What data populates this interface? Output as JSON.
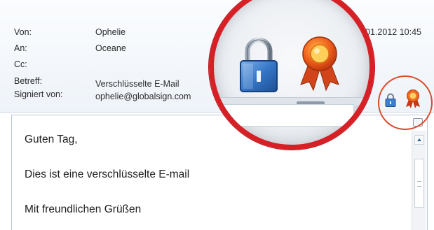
{
  "header": {
    "fields": [
      {
        "label": "Von:",
        "value": "Ophelie"
      },
      {
        "label": "An:",
        "value": "Oceane"
      },
      {
        "label": "Cc:",
        "value": ""
      },
      {
        "label": "Betreff:",
        "value": "Verschlüsselte E-Mail"
      },
      {
        "label": "Signiert von:",
        "value": "ophelie@globalsign.com"
      }
    ],
    "date": "11.01.2012 10:45"
  },
  "body": {
    "lines": [
      "Guten Tag,",
      "Dies ist eine verschlüsselte E-mail",
      "Mit freundlichen Grüßen"
    ]
  },
  "icons": {
    "lock": "padlock-icon",
    "seal": "certificate-seal-icon",
    "accent": "#d71f26",
    "lock_color": "#2f6fbf",
    "seal_color": "#e8531a"
  }
}
